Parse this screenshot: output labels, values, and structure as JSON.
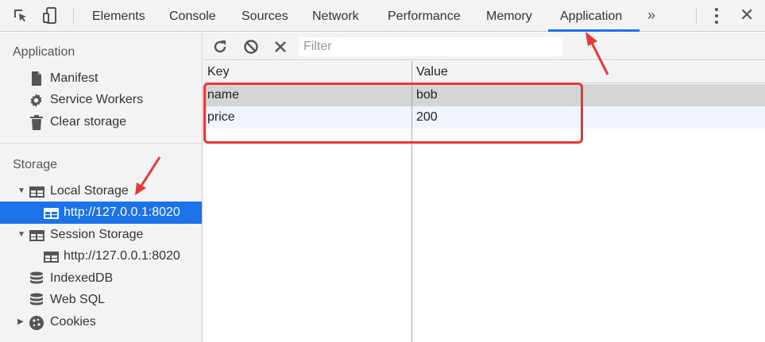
{
  "tabs": [
    "Elements",
    "Console",
    "Sources",
    "Network",
    "Performance",
    "Memory",
    "Application"
  ],
  "active_tab": "Application",
  "overflow_glyph": "»",
  "close_glyph": "✕",
  "sidebar": {
    "application_title": "Application",
    "application_items": [
      "Manifest",
      "Service Workers",
      "Clear storage"
    ],
    "storage_title": "Storage",
    "local_storage": "Local Storage",
    "local_storage_child": "http://127.0.0.1:8020",
    "session_storage": "Session Storage",
    "session_storage_child": "http://127.0.0.1:8020",
    "indexeddb": "IndexedDB",
    "websql": "Web SQL",
    "cookies": "Cookies"
  },
  "toolbar": {
    "filter_placeholder": "Filter",
    "filter_value": ""
  },
  "table": {
    "headers": [
      "Key",
      "Value"
    ],
    "rows": [
      {
        "key": "name",
        "value": "bob"
      },
      {
        "key": "price",
        "value": "200"
      }
    ]
  },
  "icons": {
    "inspect": "inspect-icon",
    "device": "device-toolbar-icon",
    "refresh": "refresh-icon",
    "clear": "clear-all-icon",
    "delete": "delete-selected-icon"
  },
  "colors": {
    "accent": "#1a73e8",
    "annotation": "#e53935"
  }
}
